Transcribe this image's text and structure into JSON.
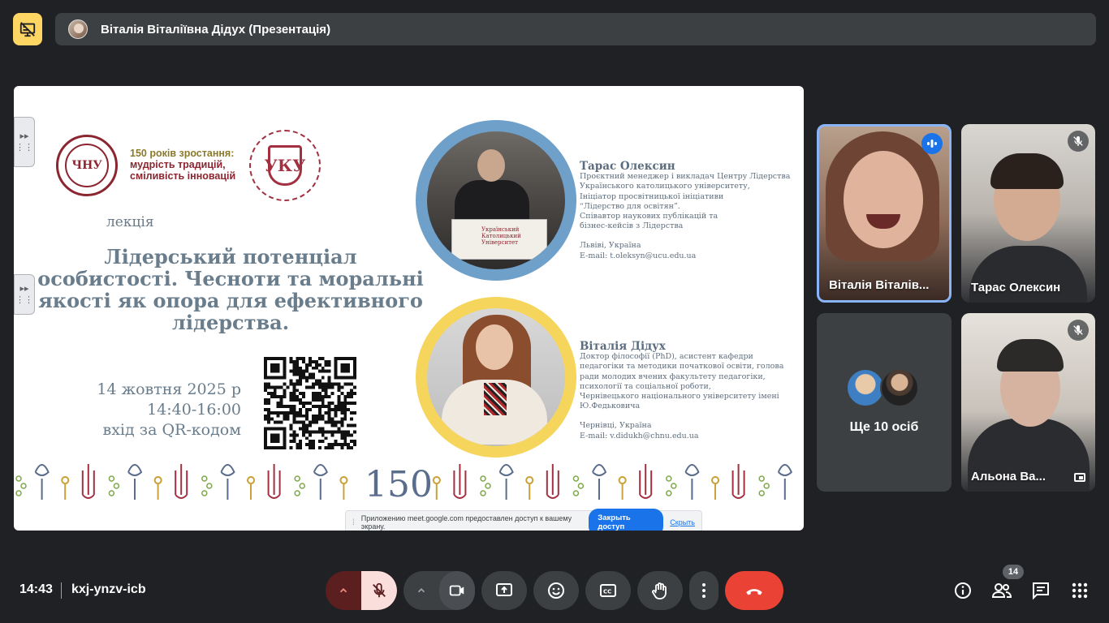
{
  "presentation_bar": {
    "title": "Віталія Віталіївна Дідух (Презентація)"
  },
  "slide": {
    "motto": [
      "150 років зростання:",
      "мудрість традицій,",
      "сміливість інновацій"
    ],
    "logo_chnu_text": "ЧНУ",
    "logo_ucu_text": "УКУ",
    "lecture_label": "лекція",
    "lecture_title": "Лідерський потенціал особистості. Чесноти та моральні якості як опора для ефективного лідерства.",
    "date": "14 жовтня 2025 р",
    "time": "14:40-16:00",
    "entry": "вхід за QR-кодом",
    "lectern_text": "Український Католицький Університет",
    "ornament_year": "150",
    "speaker1": {
      "name": "Тарас Олексин",
      "bio": [
        "Проєктний менеджер і викладач Центру Лідерства",
        "Українського католицького університету,",
        "Ініціатор просвітницької ініціативи",
        "“Лідерство для освітян”.",
        "Співавтор наукових публікацій та",
        "бізнес-кейсів з Лідерства"
      ],
      "location": "Львіві, Україна",
      "email": "E-mail: t.oleksyn@ucu.edu.ua"
    },
    "speaker2": {
      "name": "Віталія Дідух",
      "bio": [
        "Доктор філософії (PhD), асистент кафедри",
        "педагогіки та методики початкової освіти, голова",
        "ради молодих вчених факультету педагогіки,",
        "психології та соціальної роботи,",
        "Чернівецького національного університету  імені",
        "Ю.Федьковича"
      ],
      "location": "Чернівці, Україна",
      "email": "E-mail: v.didukh@chnu.edu.ua"
    },
    "share_bar": {
      "message": "Приложению meet.google.com предоставлен доступ к вашему экрану.",
      "stop_label": "Закрыть доступ",
      "hide_label": "Скрыть"
    }
  },
  "participants": [
    {
      "name": "Віталія Віталів...",
      "speaking": true
    },
    {
      "name": "Тарас Олексин",
      "muted": true
    },
    {
      "name": "Ще 10 осіб"
    },
    {
      "name": "Альона Ва...",
      "muted": true
    }
  ],
  "bottom_bar": {
    "time": "14:43",
    "meeting_code": "kxj-ynzv-icb",
    "participant_count": "14"
  },
  "icons": {
    "present_badge": "presentation-off-icon",
    "mic": "mic-off-icon",
    "camera": "videocam-icon",
    "present": "present-to-all-icon",
    "emoji": "emoji-icon",
    "captions": "closed-caption-icon",
    "hand": "raise-hand-icon",
    "more": "more-vert-icon",
    "end": "call-end-icon",
    "info": "info-icon",
    "people": "people-icon",
    "chat": "chat-icon",
    "activities": "apps-icon"
  },
  "colors": {
    "background": "#202124",
    "end_call": "#ea4335",
    "present_badge": "#fdd663",
    "speaking_border": "#8ab4f8",
    "mic_off_bg": "#f9dedc"
  }
}
